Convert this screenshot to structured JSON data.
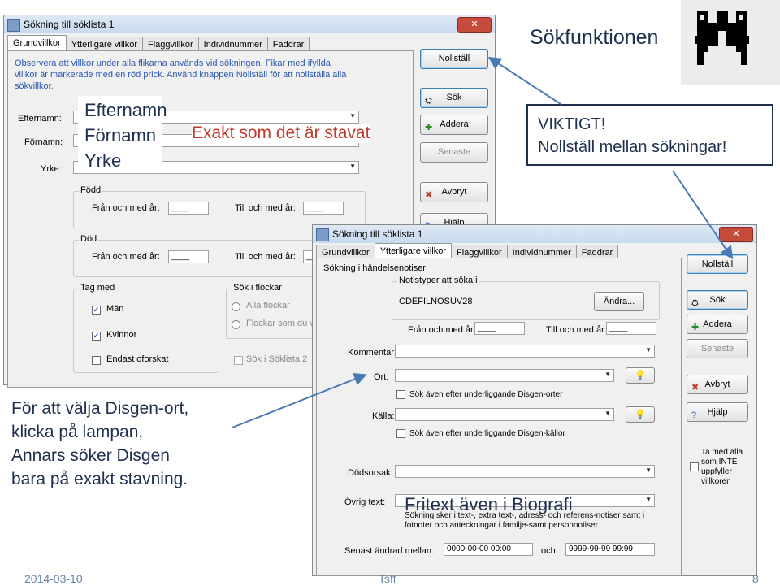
{
  "slide": {
    "title": "Sökfunktionen",
    "date": "2014-03-10",
    "center": "Tsff",
    "page": "8"
  },
  "callouts": {
    "names": [
      "Efternamn",
      "Förnamn",
      "Yrke"
    ],
    "exact": "Exakt som det är stavat",
    "important_line1": "VIKTIGT!",
    "important_line2": "Nollställ mellan sökningar!",
    "ort_line1": "För att välja Disgen-ort,",
    "ort_line2": "klicka på lampan,",
    "ort_line3": "Annars söker Disgen",
    "ort_line4": "bara på exakt stavning.",
    "fritext": "Fritext även i Biografi"
  },
  "win1": {
    "title": "Sökning till söklista 1",
    "tabs": [
      "Grundvillkor",
      "Ytterligare villkor",
      "Flaggvillkor",
      "Individnummer",
      "Faddrar"
    ],
    "info": "Observera att villkor under alla flikarna används vid sökningen. Fikar med ifyllda villkor är markerade med en röd prick. Använd knappen Nollställ för att nollställa alla sökvillkor.",
    "efternamn": "Efternamn:",
    "fornamn": "Förnamn:",
    "yrke": "Yrke:",
    "fodd": "Född",
    "dod": "Död",
    "from_label": "Från och med år:",
    "to_label": "Till och med år:",
    "year_placeholder": "____",
    "tag_med": "Tag med",
    "man": "Män",
    "kvinnor": "Kvinnor",
    "endast": "Endast oforskat",
    "sok_i_flockar": "Sök i flockar",
    "alla_flockar": "Alla flockar",
    "flockar_som": "Flockar som du välj",
    "sok_i_soklista": "Sök i Söklista 2",
    "buttons": {
      "nollstall": "Nollställ",
      "sok": "Sök",
      "addera": "Addera",
      "senaste": "Senaste",
      "avbryt": "Avbryt",
      "hjalp": "Hjälp"
    }
  },
  "win2": {
    "title": "Sökning till söklista 1",
    "tabs": [
      "Grundvillkor",
      "Ytterligare villkor",
      "Flaggvillkor",
      "Individnummer",
      "Faddrar"
    ],
    "section": "Sökning i händelsenotiser",
    "notistyper": "Notistyper att söka i",
    "notistyper_value": "CDEFILNOSUV28",
    "andra": "Ändra...",
    "from_label": "Från och med år:",
    "to_label": "Till och med år:",
    "year_placeholder": "____",
    "kommentar": "Kommentar:",
    "ort": "Ort:",
    "sok_ort": "Sök även efter underliggande Disgen-orter",
    "kalla": "Källa:",
    "sok_kalla": "Sök även efter underliggande Disgen-källor",
    "dodsorsak": "Dödsorsak:",
    "ovrig_text": "Övrig text:",
    "ovrig_info": "Sökning sker i text-, extra text-, adress- och referens-notiser samt i fotnoter och anteckningar i familje-samt personnotiser.",
    "senast": "Senast ändrad mellan:",
    "och": "och:",
    "date_from": "0000-00-00 00:00",
    "date_to": "9999-99-99 99:99",
    "ta_med": "Ta med alla som INTE uppfyller villkoren",
    "buttons": {
      "nollstall": "Nollställ",
      "sok": "Sök",
      "addera": "Addera",
      "senaste": "Senaste",
      "avbryt": "Avbryt",
      "hjalp": "Hjälp"
    }
  }
}
